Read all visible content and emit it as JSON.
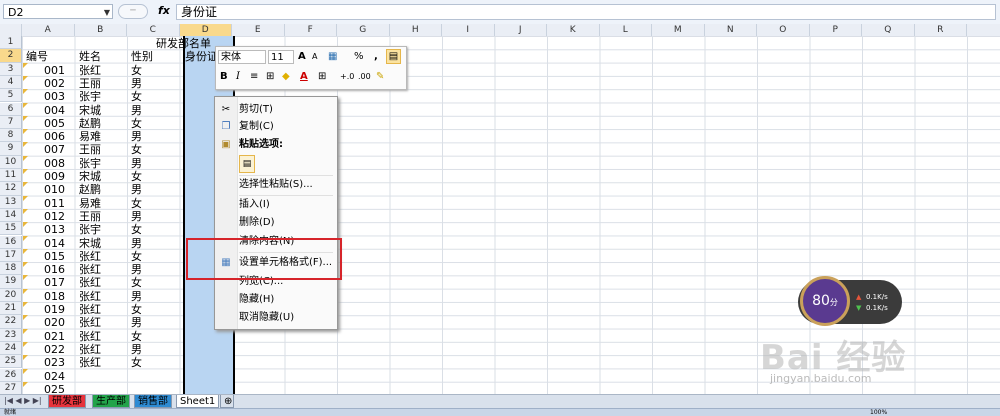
{
  "formula_bar": {
    "name_box": "D2",
    "fx": "fx",
    "content": "身份证"
  },
  "columns": [
    "A",
    "B",
    "C",
    "D",
    "E",
    "F",
    "G",
    "H",
    "I",
    "J",
    "K",
    "L",
    "M",
    "N",
    "O",
    "P",
    "Q",
    "R"
  ],
  "rows": [
    "1",
    "2",
    "3",
    "4",
    "5",
    "6",
    "7",
    "8",
    "9",
    "10",
    "11",
    "12",
    "13",
    "14",
    "15",
    "16",
    "17",
    "18",
    "19",
    "20",
    "21",
    "22",
    "23",
    "24",
    "25",
    "26",
    "27"
  ],
  "sheet": {
    "title": "研发部名单",
    "headers": {
      "a": "编号",
      "b": "姓名",
      "c": "性别",
      "d": "身份证"
    },
    "records": [
      [
        "001",
        "张红",
        "女"
      ],
      [
        "002",
        "王丽",
        "男"
      ],
      [
        "003",
        "张宇",
        "女"
      ],
      [
        "004",
        "宋城",
        "男"
      ],
      [
        "005",
        "赵鹏",
        "女"
      ],
      [
        "006",
        "易难",
        "男"
      ],
      [
        "007",
        "王丽",
        "女"
      ],
      [
        "008",
        "张宇",
        "男"
      ],
      [
        "009",
        "宋城",
        "女"
      ],
      [
        "010",
        "赵鹏",
        "男"
      ],
      [
        "011",
        "易难",
        "女"
      ],
      [
        "012",
        "王丽",
        "男"
      ],
      [
        "013",
        "张宇",
        "女"
      ],
      [
        "014",
        "宋城",
        "男"
      ],
      [
        "015",
        "张红",
        "女"
      ],
      [
        "016",
        "张红",
        "男"
      ],
      [
        "017",
        "张红",
        "女"
      ],
      [
        "018",
        "张红",
        "男"
      ],
      [
        "019",
        "张红",
        "女"
      ],
      [
        "020",
        "张红",
        "男"
      ],
      [
        "021",
        "张红",
        "女"
      ],
      [
        "022",
        "张红",
        "男"
      ],
      [
        "023",
        "张红",
        "女"
      ],
      [
        "024",
        "",
        ""
      ],
      [
        "025",
        "",
        ""
      ]
    ]
  },
  "mini_toolbar": {
    "font": "宋体",
    "size": "11",
    "grow": "A",
    "shrink": "A",
    "percent": "%",
    "comma": ",",
    "bold": "B",
    "italic": "I",
    "font_color": "A",
    "inc_dec": "+.0",
    "dec_dec": ".00"
  },
  "context_menu": {
    "cut": "剪切(T)",
    "copy": "复制(C)",
    "paste_options": "粘贴选项:",
    "paste_special": "选择性粘贴(S)...",
    "insert": "插入(I)",
    "delete": "删除(D)",
    "clear": "清除内容(N)",
    "format_cells": "设置单元格格式(F)...",
    "col_width": "列宽(C)...",
    "hide": "隐藏(H)",
    "unhide": "取消隐藏(U)"
  },
  "widget": {
    "score": "80",
    "unit": "分",
    "up": "0.1K/s",
    "down": "0.1K/s"
  },
  "watermark": {
    "brand": "Bai 经验",
    "url": "jingyan.baidu.com"
  },
  "tabs": [
    {
      "label": "研发部",
      "color": "#e7333c"
    },
    {
      "label": "生产部",
      "color": "#22a34a"
    },
    {
      "label": "销售部",
      "color": "#2e8bd3"
    },
    {
      "label": "Sheet1",
      "color": "#ffffff"
    }
  ],
  "status": {
    "left": "就绪",
    "zoom": "100%"
  }
}
